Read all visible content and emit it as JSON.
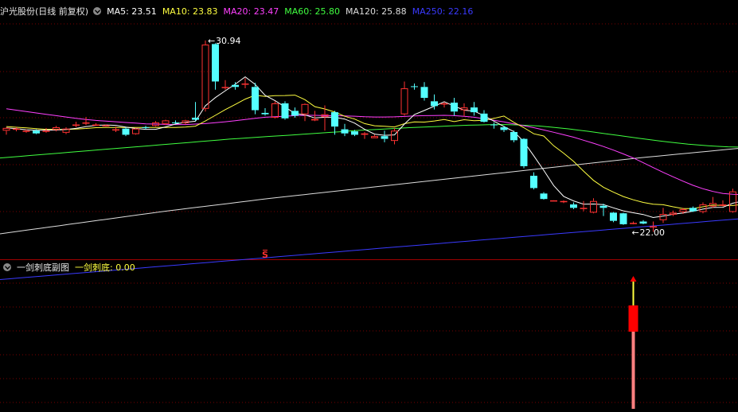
{
  "main_header": {
    "title": "沪光股份(日线 前复权)",
    "ma_items": [
      {
        "label": "MA5: 23.51",
        "color": "#ffffff"
      },
      {
        "label": "MA10: 23.83",
        "color": "#ffff40"
      },
      {
        "label": "MA20: 23.47",
        "color": "#ff40ff"
      },
      {
        "label": "MA60: 25.80",
        "color": "#40ff40"
      },
      {
        "label": "MA120: 25.88",
        "color": "#dddddd"
      },
      {
        "label": "MA250: 22.16",
        "color": "#3a3aff"
      }
    ]
  },
  "sub_header": {
    "title": "一剑刺底副图",
    "indicator_label": "一剑刺底",
    "indicator_value": ": 0.00",
    "indicator_color": "#ffff40"
  },
  "annotations": {
    "high_label": "30.94",
    "low_label": "22.00",
    "marker": "S"
  },
  "colors": {
    "up": "#ff3232",
    "down": "#54ffff",
    "grid": "#7a0000",
    "divider": "#a00000",
    "ma5": "#ffffff",
    "ma10": "#ffff40",
    "ma20": "#ff40ff",
    "ma60": "#40ff40",
    "ma120": "#dddddd",
    "ma250": "#3a3aff",
    "signal_top": "#ffff40",
    "signal_body": "#ff0000",
    "signal_stem": "#ff8080"
  },
  "chart_data": {
    "type": "candlestick",
    "ylim": [
      16.0,
      33.0
    ],
    "candles": [
      [
        24.6,
        24.85,
        24.3,
        24.8
      ],
      [
        24.7,
        24.85,
        24.55,
        24.75
      ],
      [
        24.55,
        24.7,
        24.45,
        24.6
      ],
      [
        24.6,
        24.7,
        24.35,
        24.4
      ],
      [
        24.55,
        24.8,
        24.45,
        24.6
      ],
      [
        24.65,
        24.95,
        24.55,
        24.85
      ],
      [
        24.45,
        24.85,
        24.35,
        24.75
      ],
      [
        25.0,
        25.25,
        24.85,
        25.05
      ],
      [
        25.15,
        25.6,
        25.0,
        25.2
      ],
      [
        25.05,
        25.15,
        24.95,
        25.05
      ],
      [
        24.95,
        25.05,
        24.9,
        25.0
      ],
      [
        24.65,
        24.9,
        24.5,
        24.7
      ],
      [
        24.75,
        24.85,
        24.2,
        24.3
      ],
      [
        24.35,
        24.8,
        24.3,
        24.75
      ],
      [
        24.85,
        24.95,
        24.7,
        24.8
      ],
      [
        24.95,
        25.3,
        24.9,
        25.2
      ],
      [
        25.1,
        25.4,
        25.0,
        25.35
      ],
      [
        25.2,
        25.35,
        25.1,
        25.15
      ],
      [
        25.15,
        25.4,
        25.05,
        25.35
      ],
      [
        25.55,
        26.7,
        25.3,
        25.4
      ],
      [
        26.2,
        31.2,
        26.0,
        30.9
      ],
      [
        30.94,
        31.0,
        27.6,
        28.2
      ],
      [
        27.8,
        28.3,
        27.6,
        27.8
      ],
      [
        27.95,
        28.15,
        27.6,
        27.8
      ],
      [
        28.0,
        28.45,
        27.7,
        28.05
      ],
      [
        27.8,
        28.1,
        25.8,
        26.1
      ],
      [
        25.9,
        26.25,
        25.7,
        25.8
      ],
      [
        25.55,
        26.75,
        25.5,
        26.6
      ],
      [
        26.6,
        26.75,
        25.4,
        25.5
      ],
      [
        26.05,
        26.3,
        25.55,
        25.7
      ],
      [
        25.8,
        26.6,
        25.3,
        26.55
      ],
      [
        25.35,
        26.05,
        25.3,
        25.45
      ],
      [
        25.6,
        26.45,
        24.6,
        25.8
      ],
      [
        25.95,
        26.05,
        24.3,
        24.9
      ],
      [
        24.7,
        25.1,
        24.2,
        24.4
      ],
      [
        24.55,
        24.65,
        24.2,
        24.3
      ],
      [
        24.3,
        24.5,
        24.0,
        24.4
      ],
      [
        24.05,
        24.3,
        24.05,
        24.2
      ],
      [
        24.2,
        24.6,
        23.75,
        24.0
      ],
      [
        23.85,
        24.8,
        23.6,
        24.6
      ],
      [
        25.8,
        28.2,
        25.7,
        27.7
      ],
      [
        27.85,
        28.05,
        27.6,
        27.8
      ],
      [
        27.8,
        28.15,
        26.8,
        27.0
      ],
      [
        26.75,
        27.25,
        26.15,
        26.4
      ],
      [
        26.55,
        26.7,
        26.3,
        26.6
      ],
      [
        26.65,
        27.0,
        25.7,
        26.0
      ],
      [
        26.1,
        26.6,
        25.65,
        26.3
      ],
      [
        26.3,
        26.7,
        25.7,
        25.95
      ],
      [
        25.85,
        26.1,
        25.2,
        25.25
      ],
      [
        25.05,
        25.2,
        24.75,
        25.0
      ],
      [
        24.85,
        24.95,
        24.5,
        24.65
      ],
      [
        24.5,
        24.6,
        23.75,
        23.9
      ],
      [
        24.0,
        24.05,
        21.85,
        22.0
      ],
      [
        21.3,
        21.55,
        20.3,
        20.4
      ],
      [
        20.0,
        20.1,
        19.55,
        19.6
      ],
      [
        19.5,
        19.5,
        19.45,
        19.5
      ],
      [
        19.45,
        19.5,
        19.3,
        19.45
      ],
      [
        19.2,
        19.35,
        18.85,
        18.95
      ],
      [
        18.95,
        19.45,
        18.7,
        18.95
      ],
      [
        18.6,
        19.65,
        18.55,
        19.45
      ],
      [
        19.1,
        19.25,
        18.35,
        18.95
      ],
      [
        18.6,
        18.65,
        17.9,
        18.0
      ],
      [
        18.55,
        18.6,
        17.7,
        17.75
      ],
      [
        17.8,
        17.95,
        17.75,
        17.85
      ],
      [
        17.95,
        18.05,
        17.75,
        17.8
      ],
      [
        17.55,
        17.95,
        17.2,
        17.6
      ],
      [
        18.05,
        18.95,
        17.85,
        18.5
      ],
      [
        18.45,
        18.75,
        18.35,
        18.6
      ],
      [
        18.65,
        18.95,
        18.5,
        18.85
      ],
      [
        18.95,
        19.05,
        18.65,
        18.7
      ],
      [
        18.65,
        19.35,
        18.55,
        19.2
      ],
      [
        19.05,
        19.75,
        18.95,
        19.3
      ],
      [
        19.1,
        19.5,
        19.05,
        19.2
      ],
      [
        18.65,
        20.35,
        18.6,
        20.15
      ],
      [
        20.35,
        20.4,
        19.05,
        19.05
      ]
    ],
    "ma5": [
      24.8,
      24.75,
      24.67,
      24.63,
      24.64,
      24.64,
      24.69,
      24.77,
      24.89,
      24.99,
      25.02,
      24.99,
      24.86,
      24.76,
      24.7,
      24.7,
      24.88,
      25.09,
      25.21,
      25.29,
      26.42,
      27.02,
      27.52,
      28.0,
      28.54,
      27.99,
      27.19,
      26.8,
      26.33,
      25.86,
      25.75,
      25.53,
      25.58,
      25.58,
      25.45,
      25.15,
      24.7,
      24.35,
      24.26,
      24.29,
      25.08,
      25.78,
      26.08,
      26.39,
      26.72,
      26.4,
      26.1,
      26.03,
      25.7,
      25.29,
      24.9,
      24.53,
      23.79,
      22.76,
      21.7,
      20.58,
      19.79,
      19.46,
      19.22,
      19.23,
      19.19,
      18.95,
      18.73,
      18.59,
      18.46,
      18.24,
      18.35,
      18.48,
      18.58,
      18.71,
      18.86,
      18.98,
      18.99,
      19.29,
      19.46
    ],
    "ma10": [
      24.9,
      24.85,
      24.8,
      24.75,
      24.7,
      24.7,
      24.69,
      24.72,
      24.76,
      24.82,
      24.84,
      24.83,
      24.83,
      24.83,
      24.83,
      24.84,
      24.83,
      24.83,
      24.86,
      24.93,
      25.31,
      25.72,
      26.14,
      26.52,
      26.91,
      27.2,
      27.1,
      27.16,
      27.17,
      27.2,
      26.87,
      26.36,
      26.19,
      25.96,
      25.65,
      25.45,
      25.12,
      24.96,
      24.92,
      24.87,
      25.11,
      25.24,
      25.23,
      25.31,
      25.42,
      25.26,
      25.4,
      25.33,
      25.36,
      25.5,
      25.67,
      25.21,
      24.82,
      24.37,
      24.21,
      23.49,
      22.95,
      22.35,
      21.64,
      20.96,
      20.46,
      20.1,
      19.78,
      19.54,
      19.35,
      19.22,
      19.18,
      19.03,
      18.9,
      18.9,
      19.03,
      19.16,
      19.12,
      19.12,
      19.21
    ],
    "ma20": [
      26.2,
      26.1,
      26.0,
      25.9,
      25.8,
      25.7,
      25.6,
      25.5,
      25.42,
      25.35,
      25.3,
      25.25,
      25.2,
      25.15,
      25.1,
      25.08,
      25.06,
      25.05,
      25.05,
      25.08,
      25.12,
      25.18,
      25.25,
      25.33,
      25.42,
      25.5,
      25.58,
      25.62,
      25.66,
      25.7,
      25.72,
      25.72,
      25.7,
      25.7,
      25.68,
      25.66,
      25.62,
      25.6,
      25.6,
      25.61,
      25.64,
      25.68,
      25.7,
      25.71,
      25.72,
      25.7,
      25.65,
      25.58,
      25.48,
      25.36,
      25.24,
      25.1,
      24.96,
      24.82,
      24.65,
      24.48,
      24.3,
      24.12,
      23.9,
      23.68,
      23.44,
      23.18,
      22.9,
      22.6,
      22.25,
      21.9,
      21.55,
      21.22,
      20.9,
      20.6,
      20.35,
      20.15,
      20.0,
      19.95,
      19.92
    ],
    "ma60": [
      22.6,
      22.66,
      22.72,
      22.78,
      22.84,
      22.9,
      22.96,
      23.02,
      23.08,
      23.14,
      23.2,
      23.26,
      23.32,
      23.38,
      23.44,
      23.5,
      23.56,
      23.62,
      23.68,
      23.74,
      23.8,
      23.86,
      23.92,
      23.98,
      24.03,
      24.08,
      24.13,
      24.18,
      24.22,
      24.27,
      24.32,
      24.37,
      24.42,
      24.47,
      24.52,
      24.57,
      24.62,
      24.66,
      24.7,
      24.74,
      24.78,
      24.82,
      24.85,
      24.88,
      24.91,
      24.94,
      24.97,
      25.0,
      25.02,
      25.04,
      25.05,
      25.04,
      25.02,
      24.98,
      24.94,
      24.88,
      24.81,
      24.73,
      24.64,
      24.55,
      24.45,
      24.35,
      24.25,
      24.15,
      24.05,
      23.95,
      23.86,
      23.77,
      23.69,
      23.61,
      23.55,
      23.5,
      23.45,
      23.42,
      23.4
    ],
    "ma120": [
      17.05,
      17.15,
      17.25,
      17.35,
      17.45,
      17.55,
      17.65,
      17.75,
      17.85,
      17.95,
      18.05,
      18.15,
      18.25,
      18.35,
      18.45,
      18.55,
      18.65,
      18.74,
      18.83,
      18.92,
      19.01,
      19.1,
      19.19,
      19.28,
      19.37,
      19.46,
      19.55,
      19.64,
      19.72,
      19.8,
      19.88,
      19.96,
      20.04,
      20.12,
      20.2,
      20.28,
      20.36,
      20.44,
      20.52,
      20.6,
      20.68,
      20.76,
      20.84,
      20.92,
      21.0,
      21.08,
      21.16,
      21.24,
      21.32,
      21.4,
      21.48,
      21.56,
      21.64,
      21.72,
      21.8,
      21.88,
      21.96,
      22.04,
      22.12,
      22.2,
      22.28,
      22.36,
      22.44,
      22.52,
      22.6,
      22.67,
      22.74,
      22.81,
      22.88,
      22.95,
      23.02,
      23.09,
      23.16,
      23.23,
      23.3
    ],
    "ma250": [
      13.7,
      13.76,
      13.82,
      13.88,
      13.94,
      14.0,
      14.06,
      14.12,
      14.18,
      14.24,
      14.3,
      14.36,
      14.42,
      14.48,
      14.54,
      14.6,
      14.66,
      14.72,
      14.78,
      14.84,
      14.9,
      14.96,
      15.02,
      15.08,
      15.14,
      15.2,
      15.26,
      15.32,
      15.38,
      15.44,
      15.5,
      15.56,
      15.62,
      15.68,
      15.74,
      15.8,
      15.86,
      15.92,
      15.98,
      16.04,
      16.1,
      16.16,
      16.22,
      16.28,
      16.34,
      16.4,
      16.46,
      16.52,
      16.58,
      16.64,
      16.7,
      16.76,
      16.82,
      16.88,
      16.94,
      17.0,
      17.06,
      17.12,
      17.18,
      17.24,
      17.3,
      17.36,
      17.42,
      17.48,
      17.54,
      17.6,
      17.66,
      17.72,
      17.78,
      17.84,
      17.9,
      17.96,
      18.02,
      18.08,
      18.14
    ],
    "high_index": 20,
    "low_index": 63,
    "marker_index": 26,
    "signal_index": 63
  }
}
